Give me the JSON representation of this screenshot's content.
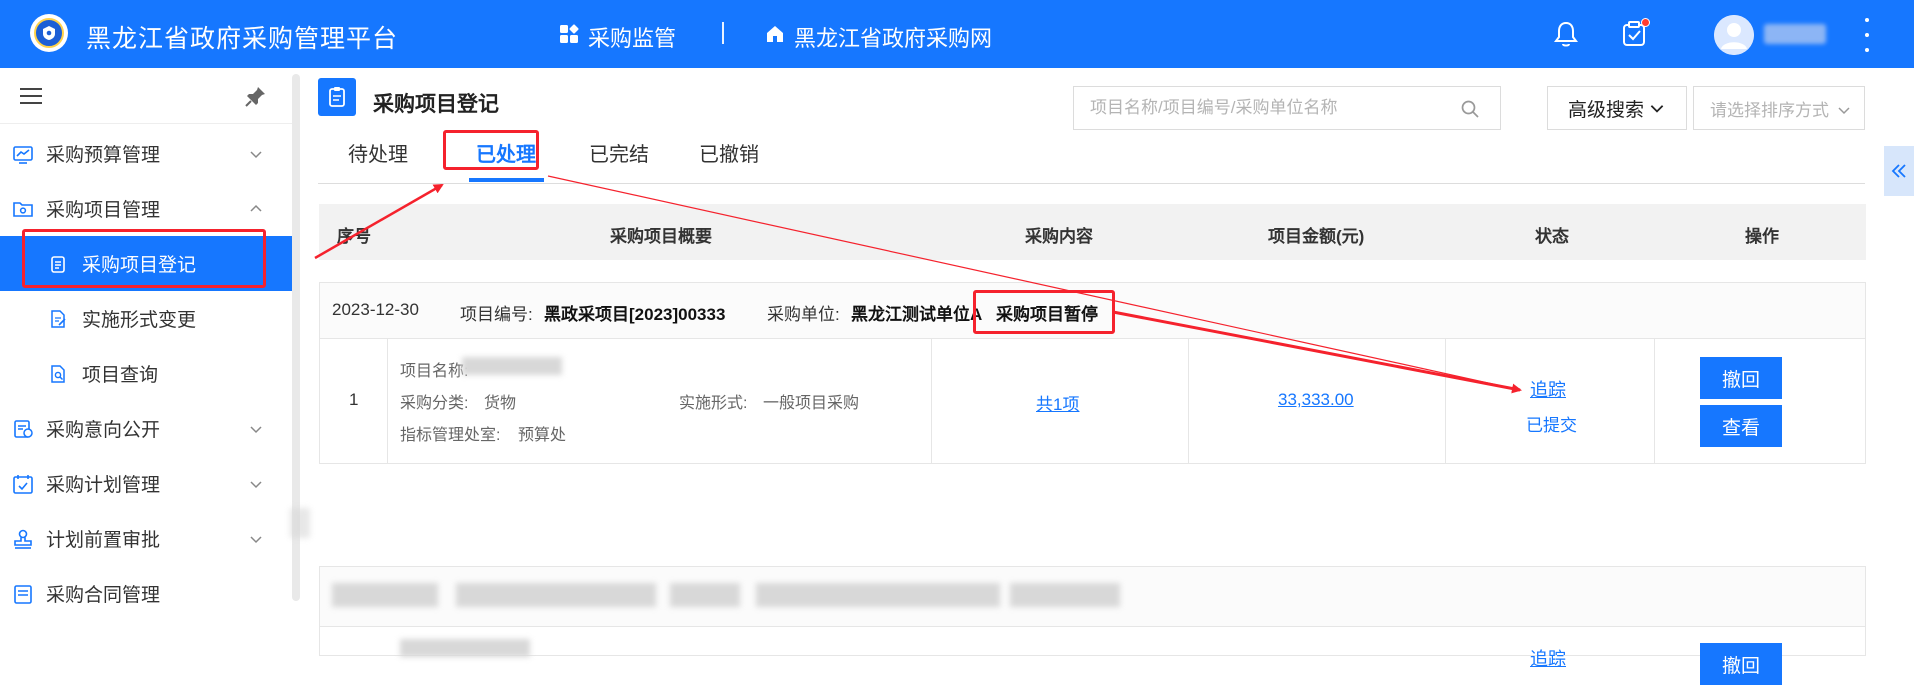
{
  "header": {
    "app_title": "黑龙江省政府采购管理平台",
    "nav": [
      {
        "label": "采购监管",
        "icon": "apps-grid-icon"
      },
      {
        "label": "黑龙江省政府采购网",
        "icon": "home-icon"
      }
    ],
    "icons": [
      "bell-icon",
      "task-clipboard-icon"
    ],
    "notification_dot_color": "#ff3b30",
    "brand_color": "#1677ff"
  },
  "sidebar": {
    "items": [
      {
        "label": "采购预算管理",
        "expanded": false
      },
      {
        "label": "采购项目管理",
        "expanded": true
      },
      {
        "label": "采购意向公开",
        "expanded": false
      },
      {
        "label": "采购计划管理",
        "expanded": false
      },
      {
        "label": "计划前置审批",
        "expanded": false
      },
      {
        "label": "采购合同管理",
        "expanded": false
      }
    ],
    "subitems": [
      {
        "label": "采购项目登记",
        "active": true
      },
      {
        "label": "实施形式变更",
        "active": false
      },
      {
        "label": "项目查询",
        "active": false
      }
    ]
  },
  "page": {
    "title": "采购项目登记",
    "search_placeholder": "项目名称/项目编号/采购单位名称",
    "advanced_search_label": "高级搜索",
    "sort_placeholder": "请选择排序方式",
    "tabs": [
      {
        "label": "待处理",
        "active": false
      },
      {
        "label": "已处理",
        "active": true
      },
      {
        "label": "已完结",
        "active": false
      },
      {
        "label": "已撤销",
        "active": false
      }
    ]
  },
  "table": {
    "columns": [
      "序号",
      "采购项目概要",
      "采购内容",
      "项目金额(元)",
      "状态",
      "操作"
    ],
    "groups": [
      {
        "date": "2023-12-30",
        "project_no_label": "项目编号:",
        "project_no": "黑政采项目[2023]00333",
        "unit_label": "采购单位:",
        "unit": "黑龙江测试单位A",
        "flag": "采购项目暂停",
        "row": {
          "index": "1",
          "name_label": "项目名称:",
          "category_label": "采购分类:",
          "category": "货物",
          "impl_label": "实施形式:",
          "impl": "一般项目采购",
          "dept_label": "指标管理处室:",
          "dept": "预算处",
          "content_link": "共1项",
          "amount": "33,333.00",
          "status_link": "追踪",
          "status": "已提交",
          "actions": [
            "撤回",
            "查看"
          ]
        }
      }
    ],
    "second_group_partial": {
      "status_link": "追踪",
      "action": "撤回"
    }
  },
  "annotation_color": "#f5222d"
}
